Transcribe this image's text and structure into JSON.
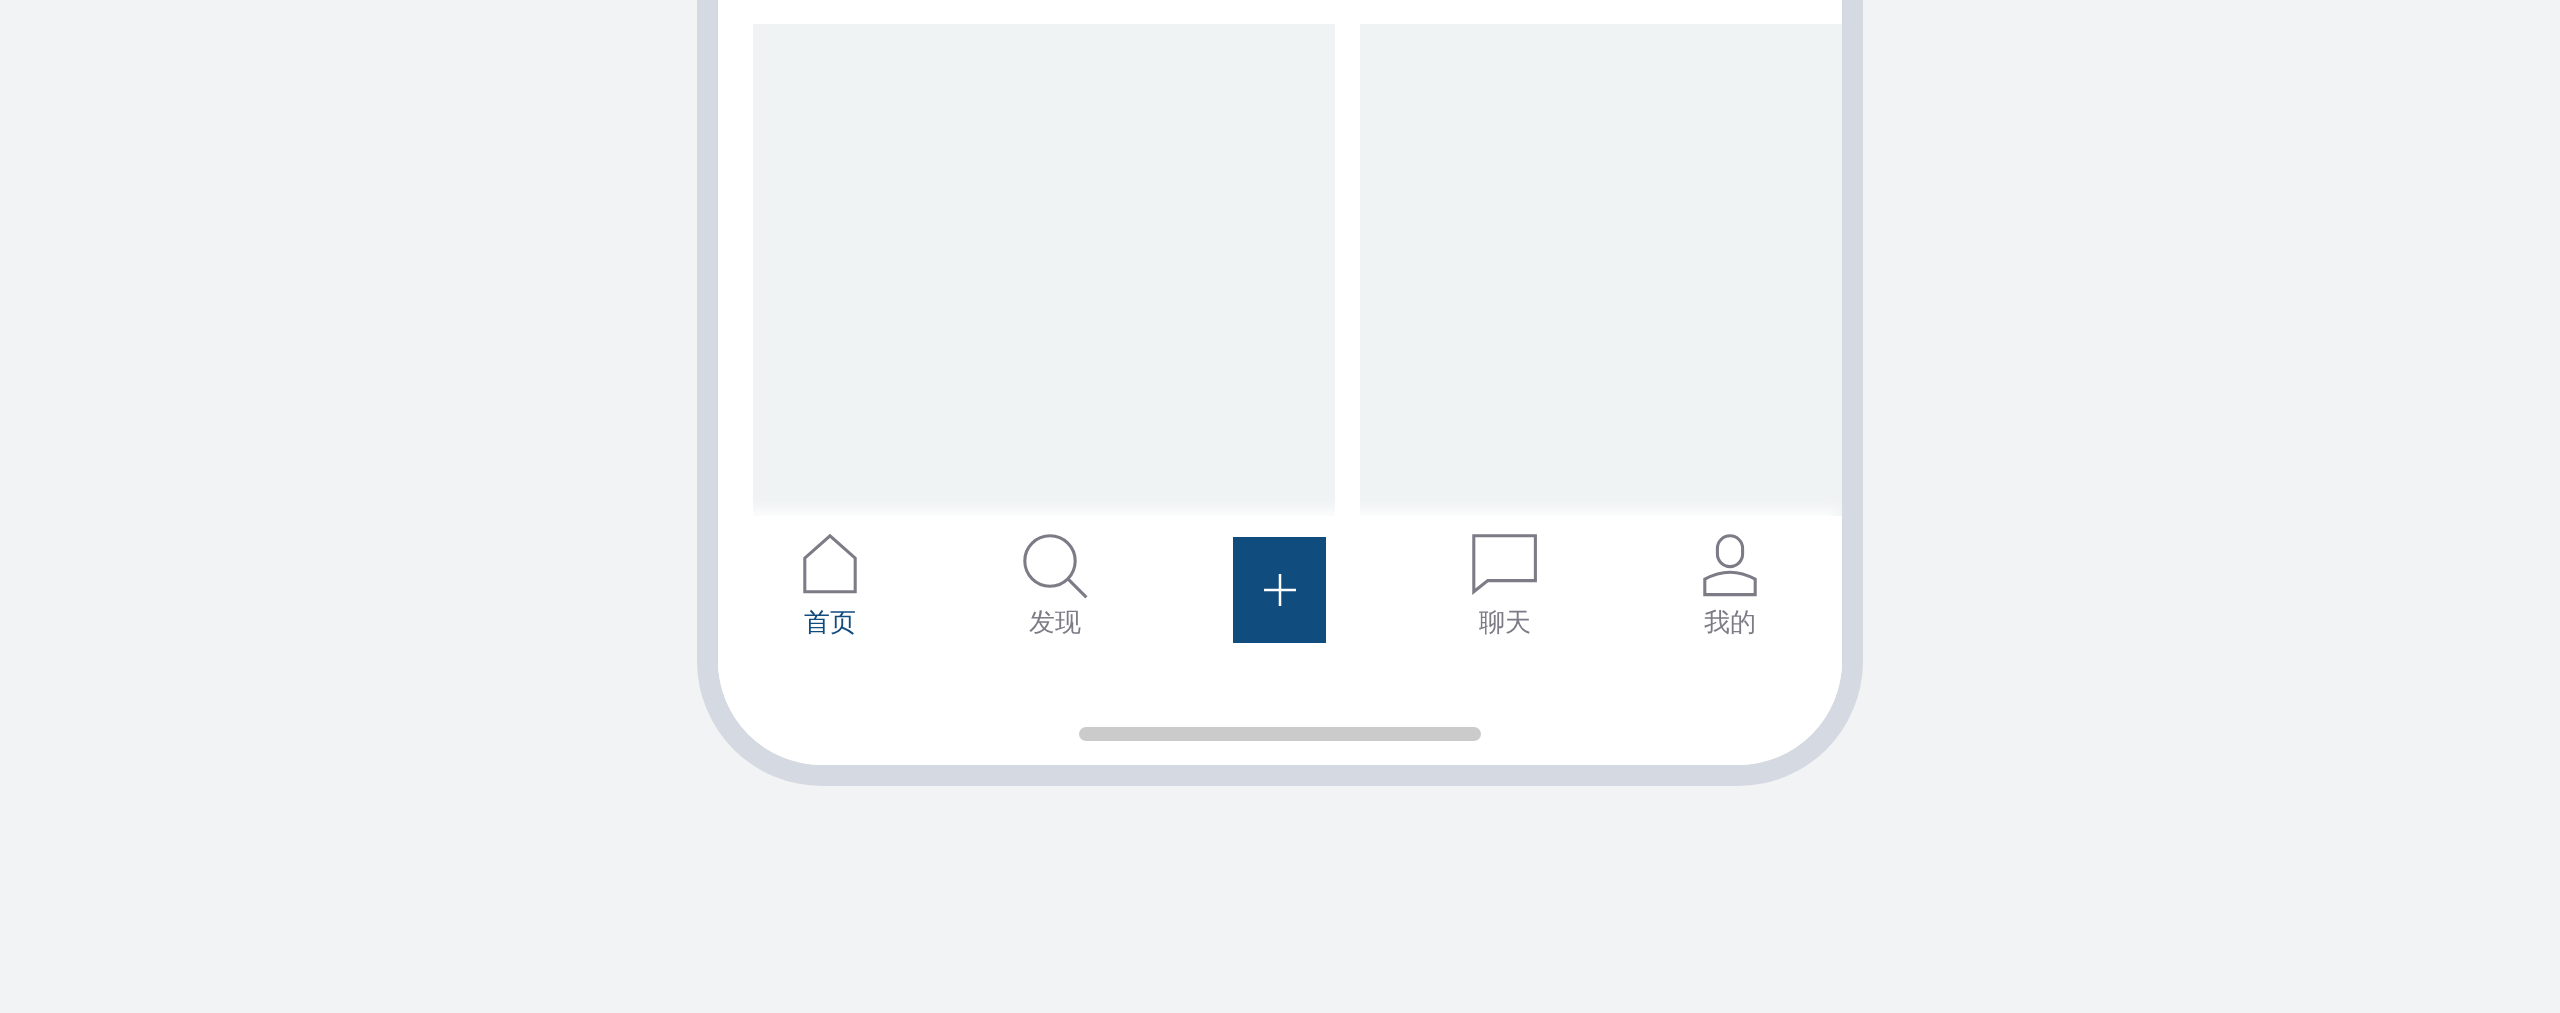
{
  "tab_bar": {
    "items": [
      {
        "kind": "tab",
        "label": "首页",
        "selected": true
      },
      {
        "kind": "tab",
        "label": "发现",
        "selected": false
      },
      {
        "kind": "action"
      },
      {
        "kind": "tab",
        "label": "聊天",
        "selected": false
      },
      {
        "kind": "tab",
        "label": "我的",
        "selected": false
      }
    ]
  }
}
